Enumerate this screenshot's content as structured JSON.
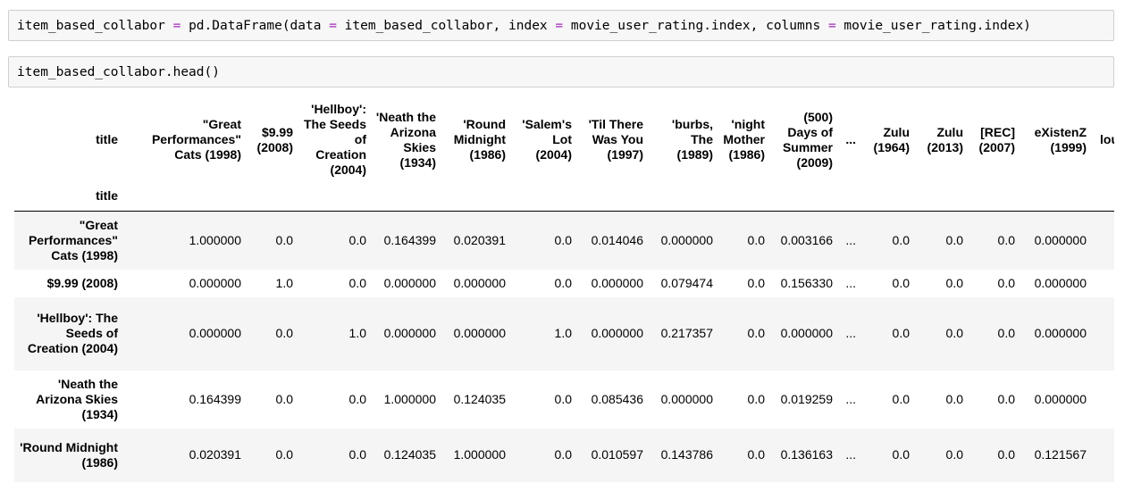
{
  "cell1": {
    "code_parts": [
      "item_based_collabor ",
      "=",
      " pd.DataFrame(data ",
      "=",
      " item_based_collabor, index ",
      "=",
      " movie_user_rating.index, columns ",
      "=",
      " movie_user_rating.index)"
    ]
  },
  "cell2": {
    "code": "item_based_collabor.head()"
  },
  "table": {
    "columns_name": "title",
    "index_name": "title",
    "columns": [
      "\"Great Performances\" Cats (1998)",
      "$9.99 (2008)",
      "'Hellboy': The Seeds of Creation (2004)",
      "'Neath the Arizona Skies (1934)",
      "'Round Midnight (1986)",
      "'Salem's Lot (2004)",
      "'Til There Was You (1997)",
      "'burbs, The (1989)",
      "'night Mother (1986)",
      "(500) Days of Summer (2009)",
      "...",
      "Zulu (1964)",
      "Zulu (2013)",
      "[REC] (2007)",
      "eXistenZ (1999)",
      "lou"
    ],
    "rows": [
      {
        "label": "\"Great Performances\" Cats (1998)",
        "values": [
          "1.000000",
          "0.0",
          "0.0",
          "0.164399",
          "0.020391",
          "0.0",
          "0.014046",
          "0.000000",
          "0.0",
          "0.003166",
          "...",
          "0.0",
          "0.0",
          "0.0",
          "0.000000"
        ]
      },
      {
        "label": "$9.99 (2008)",
        "values": [
          "0.000000",
          "1.0",
          "0.0",
          "0.000000",
          "0.000000",
          "0.0",
          "0.000000",
          "0.079474",
          "0.0",
          "0.156330",
          "...",
          "0.0",
          "0.0",
          "0.0",
          "0.000000"
        ]
      },
      {
        "label": "'Hellboy': The Seeds of Creation (2004)",
        "values": [
          "0.000000",
          "0.0",
          "1.0",
          "0.000000",
          "0.000000",
          "1.0",
          "0.000000",
          "0.217357",
          "0.0",
          "0.000000",
          "...",
          "0.0",
          "0.0",
          "0.0",
          "0.000000"
        ]
      },
      {
        "label": "'Neath the Arizona Skies (1934)",
        "values": [
          "0.164399",
          "0.0",
          "0.0",
          "1.000000",
          "0.124035",
          "0.0",
          "0.085436",
          "0.000000",
          "0.0",
          "0.019259",
          "...",
          "0.0",
          "0.0",
          "0.0",
          "0.000000"
        ]
      },
      {
        "label": "'Round Midnight (1986)",
        "values": [
          "0.020391",
          "0.0",
          "0.0",
          "0.124035",
          "1.000000",
          "0.0",
          "0.010597",
          "0.143786",
          "0.0",
          "0.136163",
          "...",
          "0.0",
          "0.0",
          "0.0",
          "0.121567"
        ]
      }
    ]
  }
}
